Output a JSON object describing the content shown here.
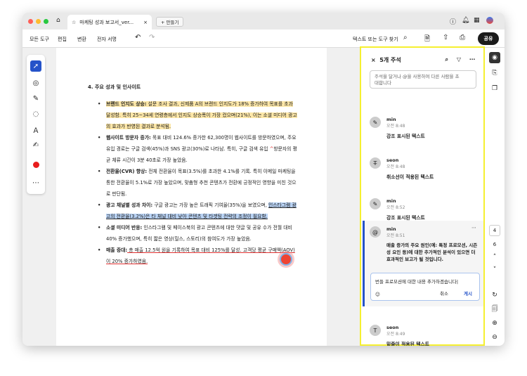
{
  "window": {
    "tab_title": "마케팅 성과 보고서_ver...",
    "new_tab": "+ 만들기"
  },
  "toolbar": {
    "all_tools": "모든 도구",
    "edit": "편집",
    "convert": "변환",
    "esign": "전자 서명",
    "search": "텍스트 또는 도구 찾기",
    "share": "공유"
  },
  "document": {
    "heading": "4. 주요 성과 및 인사이트",
    "b1_title": "브랜드 인지도 상승:",
    "b1_text": " 설문 조사 결과, 신제품 A의 브랜드 인지도가 18% 증가하여 목표를 초과 달성함. 특히 25~34세 연령층에서 인지도 상승폭이 가장 컸으며(21%), 이는 소셜 미디어 광고의 효과가 반영된 결과로 분석됨.",
    "b2_title": "웹사이트 방문자 증가:",
    "b2_text_a": " 목표 대비 124.6% 증가한 62,300명이 웹사이트를 방문하였으며, 주요 유입 경로는 구글 검색(45%)과 SNS 광고(30%)로 나타남. 특히, 구글 검색 유입 ",
    "b2_caret": "^",
    "b2_text_b": "방문자의 평균 체류 시간이 3분 40초로 가장 높았음.",
    "b3_title": "전환율(CVR) 향상:",
    "b3_text": " 전체 전환율이 목표(3.5%)를 초과한 4.1%를 기록. 특히 이메일 마케팅을 통한 전환율이 5.1%로 가장 높았으며, 맞춤형 추천 콘텐츠가 전환에 긍정적인 영향을 미친 것으로 판단됨.",
    "b4_title": "광고 채널별 성과 차이:",
    "b4_text": " 구글 광고는 가장 높은 트래픽 기여율(35%)을 보였으며, ",
    "b4_highlight": "인스타그램 광고의 전환율(3.2%)은 타 채널 대비 낮아 콘텐츠 및 타겟팅 전략의 조정이 필요함.",
    "b5_title": "소셜 미디어 반응:",
    "b5_text": " 인스타그램 및 페이스북의 광고 콘텐츠에 대한 댓글 및 공유 수가 전월 대비 40% 증가했으며, 특히 짧은 영상(릴스, 스토리)의 참여도가 가장 높았음.",
    "b6_title": "매출 증대:",
    "b6_text": " 총 매출 12.5억 원을 기록하여 목표 대비 125%를 달성. 고객당 평균 구매액(AOV)이 20% 증가하였음."
  },
  "comments_panel": {
    "title": "5개 주석",
    "input_placeholder": "주석을 달거나 @을 사용하여 다른 사람을 초대합니다",
    "comments": [
      {
        "author": "min",
        "time": "오전 8:48",
        "text": "강조 표시된 텍스트"
      },
      {
        "author": "seon",
        "time": "오전 8:48",
        "text": "취소선이 적용된 텍스트"
      },
      {
        "author": "min",
        "time": "오전 8:52",
        "text": "강조 표시된 텍스트"
      },
      {
        "author": "min",
        "time": "오전 8:51",
        "text": "매출 증가의 주요 원인(예: 특정 프로모션, 시즌성 요인 등)에 대한 추가적인 분석이 있으면 더 효과적인 보고가 될 것입니다."
      },
      {
        "author": "seon",
        "time": "오전 8:49",
        "text": "밑줄이 적용된 텍스트"
      }
    ],
    "reply_value": "번들 프로모션에 대한 내용 추가하겠습니다|",
    "cancel": "취소",
    "post": "게시"
  },
  "page_nav": {
    "current": "4",
    "total": "6"
  },
  "colors": {
    "accent": "#2553c9",
    "panel_border": "#f5ef30",
    "highlight": "#fde7a8"
  }
}
